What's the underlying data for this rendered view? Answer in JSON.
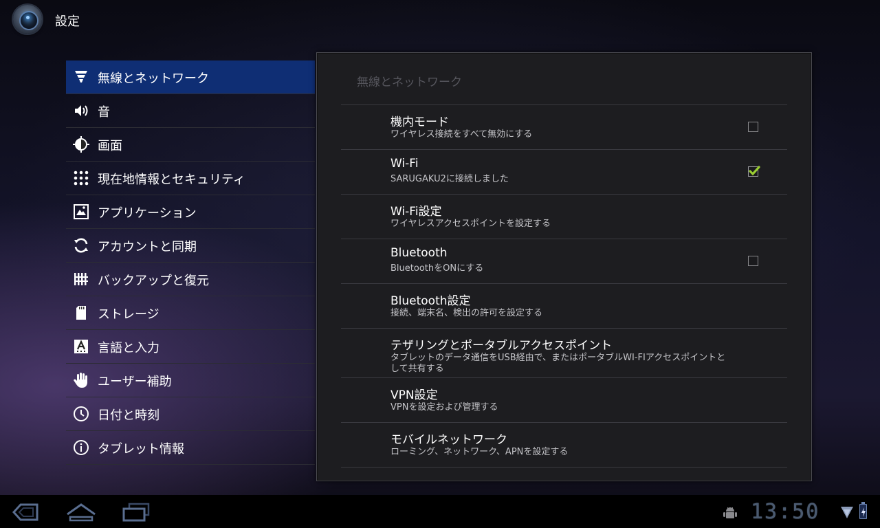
{
  "action_bar": {
    "title": "設定",
    "app_icon": "settings-app-icon"
  },
  "sidebar": {
    "selected_index": 0,
    "items": [
      {
        "label": "無線とネットワーク",
        "icon": "wireless-icon"
      },
      {
        "label": "音",
        "icon": "speaker-icon"
      },
      {
        "label": "画面",
        "icon": "brightness-icon"
      },
      {
        "label": "現在地情報とセキュリティ",
        "icon": "security-grid-icon"
      },
      {
        "label": "アプリケーション",
        "icon": "applications-icon"
      },
      {
        "label": "アカウントと同期",
        "icon": "sync-icon"
      },
      {
        "label": "バックアップと復元",
        "icon": "backup-icon"
      },
      {
        "label": "ストレージ",
        "icon": "sd-card-icon"
      },
      {
        "label": "言語と入力",
        "icon": "language-icon"
      },
      {
        "label": "ユーザー補助",
        "icon": "hand-icon"
      },
      {
        "label": "日付と時刻",
        "icon": "clock-icon"
      },
      {
        "label": "タブレット情報",
        "icon": "info-icon"
      }
    ]
  },
  "panel": {
    "header": "無線とネットワーク",
    "items": [
      {
        "title": "機内モード",
        "summary": "ワイヤレス接続をすべて無効にする",
        "has_checkbox": true,
        "checked": false
      },
      {
        "title": "Wi-Fi",
        "summary": "SARUGAKU2に接続しました",
        "has_checkbox": true,
        "checked": true
      },
      {
        "title": "Wi-Fi設定",
        "summary": "ワイヤレスアクセスポイントを設定する",
        "has_checkbox": false
      },
      {
        "title": "Bluetooth",
        "summary": "BluetoothをONにする",
        "has_checkbox": true,
        "checked": false
      },
      {
        "title": "Bluetooth設定",
        "summary": "接続、端末名、検出の許可を設定する",
        "has_checkbox": false
      },
      {
        "title": "テザリングとポータブルアクセスポイント",
        "summary": "タブレットのデータ通信をUSB経由で、またはポータブルWI-FIアクセスポイントとして共有する",
        "has_checkbox": false
      },
      {
        "title": "VPN設定",
        "summary": "VPNを設定および管理する",
        "has_checkbox": false
      },
      {
        "title": "モバイルネットワーク",
        "summary": "ローミング、ネットワーク、APNを設定する",
        "has_checkbox": false
      }
    ]
  },
  "system_bar": {
    "clock": "13:50",
    "nav": [
      "back-icon",
      "home-icon",
      "recent-apps-icon"
    ],
    "status_icons": [
      "android-debug-icon",
      "wifi-signal-icon",
      "battery-charging-icon"
    ],
    "accent_color": "#4a5a70"
  },
  "colors": {
    "selected_item": "#0f2e74",
    "checkmark": "#9acd32",
    "panel_bg": "#1d1d20"
  }
}
